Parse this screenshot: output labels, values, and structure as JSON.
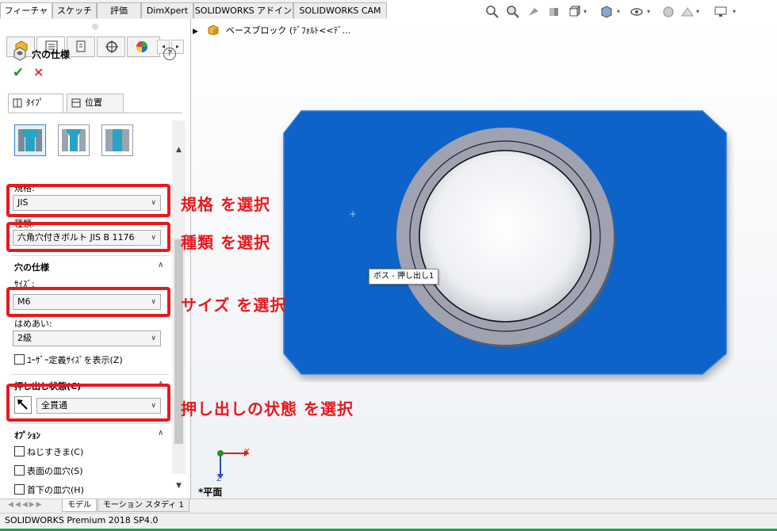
{
  "command_tabs": [
    {
      "label": "フィーチャー",
      "active": true
    },
    {
      "label": "スケッチ",
      "active": false
    },
    {
      "label": "評価",
      "active": false
    },
    {
      "label": "DimXpert",
      "active": false
    },
    {
      "label": "SOLIDWORKS アドイン",
      "active": false
    },
    {
      "label": "SOLIDWORKS CAM",
      "active": false
    }
  ],
  "panel": {
    "title": "穴の仕様",
    "help": "?",
    "ok": "✔",
    "cancel": "✕",
    "tabs": {
      "type": "ﾀｲﾌﾟ",
      "position": "位置"
    },
    "standard": {
      "label": "規格:",
      "value": "JIS"
    },
    "kind": {
      "label": "種類:",
      "value": "六角穴付きボルト JIS B 1176"
    },
    "hole_spec_section": "穴の仕様",
    "size": {
      "label": "ｻｲｽﾞ:",
      "value": "M6"
    },
    "fit": {
      "label": "はめあい:",
      "value": "2級"
    },
    "custom_size": "ﾕｰｻﾞｰ定義ｻｲｽﾞを表示(Z)",
    "end_condition": {
      "label": "押し出し状態(C)",
      "value": "全貫通"
    },
    "options_section": "ｵﾌﾟｼｮﾝ",
    "options": [
      "ねじすきま(C)",
      "表面の皿穴(S)",
      "首下の皿穴(H)"
    ]
  },
  "annotations": {
    "standard": "規格 を選択",
    "kind": "種類 を選択",
    "size": "サイズ を選択",
    "end_condition": "押し出しの状態 を選択"
  },
  "graphics": {
    "tree_node": "ベースブロック (ﾃﾞﾌｫﾙﾄ<<ﾃﾞ...",
    "tooltip": "ボス - 押し出し1",
    "view_label": "*平面",
    "axis_x": "X",
    "axis_z": "Z",
    "part_color": "#0b64c8"
  },
  "bottom_tabs": [
    "モデル",
    "モーション スタディ 1"
  ],
  "status": "SOLIDWORKS Premium 2018 SP4.0"
}
